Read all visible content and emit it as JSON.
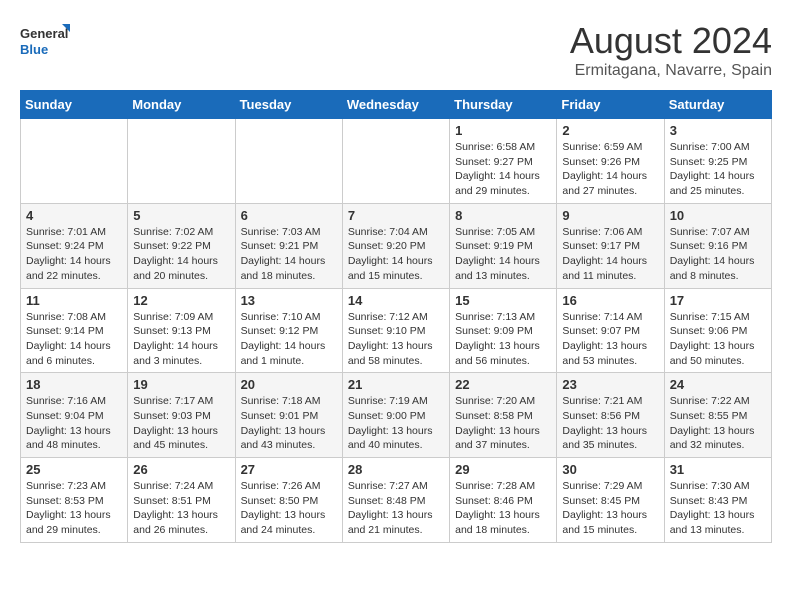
{
  "header": {
    "logo_line1": "General",
    "logo_line2": "Blue",
    "month_year": "August 2024",
    "location": "Ermitagana, Navarre, Spain"
  },
  "weekdays": [
    "Sunday",
    "Monday",
    "Tuesday",
    "Wednesday",
    "Thursday",
    "Friday",
    "Saturday"
  ],
  "weeks": [
    [
      {
        "day": "",
        "info": ""
      },
      {
        "day": "",
        "info": ""
      },
      {
        "day": "",
        "info": ""
      },
      {
        "day": "",
        "info": ""
      },
      {
        "day": "1",
        "info": "Sunrise: 6:58 AM\nSunset: 9:27 PM\nDaylight: 14 hours\nand 29 minutes."
      },
      {
        "day": "2",
        "info": "Sunrise: 6:59 AM\nSunset: 9:26 PM\nDaylight: 14 hours\nand 27 minutes."
      },
      {
        "day": "3",
        "info": "Sunrise: 7:00 AM\nSunset: 9:25 PM\nDaylight: 14 hours\nand 25 minutes."
      }
    ],
    [
      {
        "day": "4",
        "info": "Sunrise: 7:01 AM\nSunset: 9:24 PM\nDaylight: 14 hours\nand 22 minutes."
      },
      {
        "day": "5",
        "info": "Sunrise: 7:02 AM\nSunset: 9:22 PM\nDaylight: 14 hours\nand 20 minutes."
      },
      {
        "day": "6",
        "info": "Sunrise: 7:03 AM\nSunset: 9:21 PM\nDaylight: 14 hours\nand 18 minutes."
      },
      {
        "day": "7",
        "info": "Sunrise: 7:04 AM\nSunset: 9:20 PM\nDaylight: 14 hours\nand 15 minutes."
      },
      {
        "day": "8",
        "info": "Sunrise: 7:05 AM\nSunset: 9:19 PM\nDaylight: 14 hours\nand 13 minutes."
      },
      {
        "day": "9",
        "info": "Sunrise: 7:06 AM\nSunset: 9:17 PM\nDaylight: 14 hours\nand 11 minutes."
      },
      {
        "day": "10",
        "info": "Sunrise: 7:07 AM\nSunset: 9:16 PM\nDaylight: 14 hours\nand 8 minutes."
      }
    ],
    [
      {
        "day": "11",
        "info": "Sunrise: 7:08 AM\nSunset: 9:14 PM\nDaylight: 14 hours\nand 6 minutes."
      },
      {
        "day": "12",
        "info": "Sunrise: 7:09 AM\nSunset: 9:13 PM\nDaylight: 14 hours\nand 3 minutes."
      },
      {
        "day": "13",
        "info": "Sunrise: 7:10 AM\nSunset: 9:12 PM\nDaylight: 14 hours\nand 1 minute."
      },
      {
        "day": "14",
        "info": "Sunrise: 7:12 AM\nSunset: 9:10 PM\nDaylight: 13 hours\nand 58 minutes."
      },
      {
        "day": "15",
        "info": "Sunrise: 7:13 AM\nSunset: 9:09 PM\nDaylight: 13 hours\nand 56 minutes."
      },
      {
        "day": "16",
        "info": "Sunrise: 7:14 AM\nSunset: 9:07 PM\nDaylight: 13 hours\nand 53 minutes."
      },
      {
        "day": "17",
        "info": "Sunrise: 7:15 AM\nSunset: 9:06 PM\nDaylight: 13 hours\nand 50 minutes."
      }
    ],
    [
      {
        "day": "18",
        "info": "Sunrise: 7:16 AM\nSunset: 9:04 PM\nDaylight: 13 hours\nand 48 minutes."
      },
      {
        "day": "19",
        "info": "Sunrise: 7:17 AM\nSunset: 9:03 PM\nDaylight: 13 hours\nand 45 minutes."
      },
      {
        "day": "20",
        "info": "Sunrise: 7:18 AM\nSunset: 9:01 PM\nDaylight: 13 hours\nand 43 minutes."
      },
      {
        "day": "21",
        "info": "Sunrise: 7:19 AM\nSunset: 9:00 PM\nDaylight: 13 hours\nand 40 minutes."
      },
      {
        "day": "22",
        "info": "Sunrise: 7:20 AM\nSunset: 8:58 PM\nDaylight: 13 hours\nand 37 minutes."
      },
      {
        "day": "23",
        "info": "Sunrise: 7:21 AM\nSunset: 8:56 PM\nDaylight: 13 hours\nand 35 minutes."
      },
      {
        "day": "24",
        "info": "Sunrise: 7:22 AM\nSunset: 8:55 PM\nDaylight: 13 hours\nand 32 minutes."
      }
    ],
    [
      {
        "day": "25",
        "info": "Sunrise: 7:23 AM\nSunset: 8:53 PM\nDaylight: 13 hours\nand 29 minutes."
      },
      {
        "day": "26",
        "info": "Sunrise: 7:24 AM\nSunset: 8:51 PM\nDaylight: 13 hours\nand 26 minutes."
      },
      {
        "day": "27",
        "info": "Sunrise: 7:26 AM\nSunset: 8:50 PM\nDaylight: 13 hours\nand 24 minutes."
      },
      {
        "day": "28",
        "info": "Sunrise: 7:27 AM\nSunset: 8:48 PM\nDaylight: 13 hours\nand 21 minutes."
      },
      {
        "day": "29",
        "info": "Sunrise: 7:28 AM\nSunset: 8:46 PM\nDaylight: 13 hours\nand 18 minutes."
      },
      {
        "day": "30",
        "info": "Sunrise: 7:29 AM\nSunset: 8:45 PM\nDaylight: 13 hours\nand 15 minutes."
      },
      {
        "day": "31",
        "info": "Sunrise: 7:30 AM\nSunset: 8:43 PM\nDaylight: 13 hours\nand 13 minutes."
      }
    ]
  ]
}
